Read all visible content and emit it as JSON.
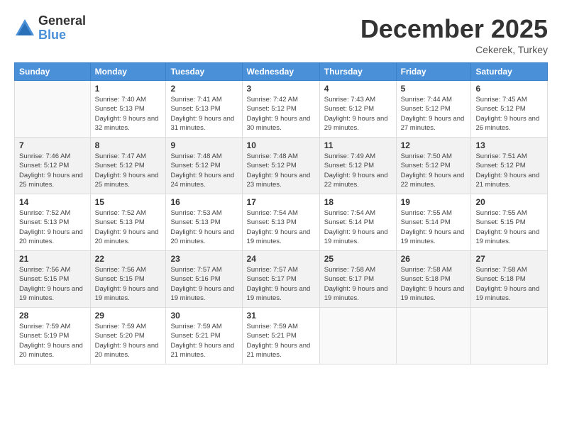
{
  "logo": {
    "general": "General",
    "blue": "Blue"
  },
  "header": {
    "month": "December 2025",
    "location": "Cekerek, Turkey"
  },
  "weekdays": [
    "Sunday",
    "Monday",
    "Tuesday",
    "Wednesday",
    "Thursday",
    "Friday",
    "Saturday"
  ],
  "weeks": [
    [
      {
        "day": "",
        "sunrise": "",
        "sunset": "",
        "daylight": ""
      },
      {
        "day": "1",
        "sunrise": "Sunrise: 7:40 AM",
        "sunset": "Sunset: 5:13 PM",
        "daylight": "Daylight: 9 hours and 32 minutes."
      },
      {
        "day": "2",
        "sunrise": "Sunrise: 7:41 AM",
        "sunset": "Sunset: 5:13 PM",
        "daylight": "Daylight: 9 hours and 31 minutes."
      },
      {
        "day": "3",
        "sunrise": "Sunrise: 7:42 AM",
        "sunset": "Sunset: 5:12 PM",
        "daylight": "Daylight: 9 hours and 30 minutes."
      },
      {
        "day": "4",
        "sunrise": "Sunrise: 7:43 AM",
        "sunset": "Sunset: 5:12 PM",
        "daylight": "Daylight: 9 hours and 29 minutes."
      },
      {
        "day": "5",
        "sunrise": "Sunrise: 7:44 AM",
        "sunset": "Sunset: 5:12 PM",
        "daylight": "Daylight: 9 hours and 27 minutes."
      },
      {
        "day": "6",
        "sunrise": "Sunrise: 7:45 AM",
        "sunset": "Sunset: 5:12 PM",
        "daylight": "Daylight: 9 hours and 26 minutes."
      }
    ],
    [
      {
        "day": "7",
        "sunrise": "Sunrise: 7:46 AM",
        "sunset": "Sunset: 5:12 PM",
        "daylight": "Daylight: 9 hours and 25 minutes."
      },
      {
        "day": "8",
        "sunrise": "Sunrise: 7:47 AM",
        "sunset": "Sunset: 5:12 PM",
        "daylight": "Daylight: 9 hours and 25 minutes."
      },
      {
        "day": "9",
        "sunrise": "Sunrise: 7:48 AM",
        "sunset": "Sunset: 5:12 PM",
        "daylight": "Daylight: 9 hours and 24 minutes."
      },
      {
        "day": "10",
        "sunrise": "Sunrise: 7:48 AM",
        "sunset": "Sunset: 5:12 PM",
        "daylight": "Daylight: 9 hours and 23 minutes."
      },
      {
        "day": "11",
        "sunrise": "Sunrise: 7:49 AM",
        "sunset": "Sunset: 5:12 PM",
        "daylight": "Daylight: 9 hours and 22 minutes."
      },
      {
        "day": "12",
        "sunrise": "Sunrise: 7:50 AM",
        "sunset": "Sunset: 5:12 PM",
        "daylight": "Daylight: 9 hours and 22 minutes."
      },
      {
        "day": "13",
        "sunrise": "Sunrise: 7:51 AM",
        "sunset": "Sunset: 5:12 PM",
        "daylight": "Daylight: 9 hours and 21 minutes."
      }
    ],
    [
      {
        "day": "14",
        "sunrise": "Sunrise: 7:52 AM",
        "sunset": "Sunset: 5:13 PM",
        "daylight": "Daylight: 9 hours and 20 minutes."
      },
      {
        "day": "15",
        "sunrise": "Sunrise: 7:52 AM",
        "sunset": "Sunset: 5:13 PM",
        "daylight": "Daylight: 9 hours and 20 minutes."
      },
      {
        "day": "16",
        "sunrise": "Sunrise: 7:53 AM",
        "sunset": "Sunset: 5:13 PM",
        "daylight": "Daylight: 9 hours and 20 minutes."
      },
      {
        "day": "17",
        "sunrise": "Sunrise: 7:54 AM",
        "sunset": "Sunset: 5:13 PM",
        "daylight": "Daylight: 9 hours and 19 minutes."
      },
      {
        "day": "18",
        "sunrise": "Sunrise: 7:54 AM",
        "sunset": "Sunset: 5:14 PM",
        "daylight": "Daylight: 9 hours and 19 minutes."
      },
      {
        "day": "19",
        "sunrise": "Sunrise: 7:55 AM",
        "sunset": "Sunset: 5:14 PM",
        "daylight": "Daylight: 9 hours and 19 minutes."
      },
      {
        "day": "20",
        "sunrise": "Sunrise: 7:55 AM",
        "sunset": "Sunset: 5:15 PM",
        "daylight": "Daylight: 9 hours and 19 minutes."
      }
    ],
    [
      {
        "day": "21",
        "sunrise": "Sunrise: 7:56 AM",
        "sunset": "Sunset: 5:15 PM",
        "daylight": "Daylight: 9 hours and 19 minutes."
      },
      {
        "day": "22",
        "sunrise": "Sunrise: 7:56 AM",
        "sunset": "Sunset: 5:15 PM",
        "daylight": "Daylight: 9 hours and 19 minutes."
      },
      {
        "day": "23",
        "sunrise": "Sunrise: 7:57 AM",
        "sunset": "Sunset: 5:16 PM",
        "daylight": "Daylight: 9 hours and 19 minutes."
      },
      {
        "day": "24",
        "sunrise": "Sunrise: 7:57 AM",
        "sunset": "Sunset: 5:17 PM",
        "daylight": "Daylight: 9 hours and 19 minutes."
      },
      {
        "day": "25",
        "sunrise": "Sunrise: 7:58 AM",
        "sunset": "Sunset: 5:17 PM",
        "daylight": "Daylight: 9 hours and 19 minutes."
      },
      {
        "day": "26",
        "sunrise": "Sunrise: 7:58 AM",
        "sunset": "Sunset: 5:18 PM",
        "daylight": "Daylight: 9 hours and 19 minutes."
      },
      {
        "day": "27",
        "sunrise": "Sunrise: 7:58 AM",
        "sunset": "Sunset: 5:18 PM",
        "daylight": "Daylight: 9 hours and 19 minutes."
      }
    ],
    [
      {
        "day": "28",
        "sunrise": "Sunrise: 7:59 AM",
        "sunset": "Sunset: 5:19 PM",
        "daylight": "Daylight: 9 hours and 20 minutes."
      },
      {
        "day": "29",
        "sunrise": "Sunrise: 7:59 AM",
        "sunset": "Sunset: 5:20 PM",
        "daylight": "Daylight: 9 hours and 20 minutes."
      },
      {
        "day": "30",
        "sunrise": "Sunrise: 7:59 AM",
        "sunset": "Sunset: 5:21 PM",
        "daylight": "Daylight: 9 hours and 21 minutes."
      },
      {
        "day": "31",
        "sunrise": "Sunrise: 7:59 AM",
        "sunset": "Sunset: 5:21 PM",
        "daylight": "Daylight: 9 hours and 21 minutes."
      },
      {
        "day": "",
        "sunrise": "",
        "sunset": "",
        "daylight": ""
      },
      {
        "day": "",
        "sunrise": "",
        "sunset": "",
        "daylight": ""
      },
      {
        "day": "",
        "sunrise": "",
        "sunset": "",
        "daylight": ""
      }
    ]
  ]
}
